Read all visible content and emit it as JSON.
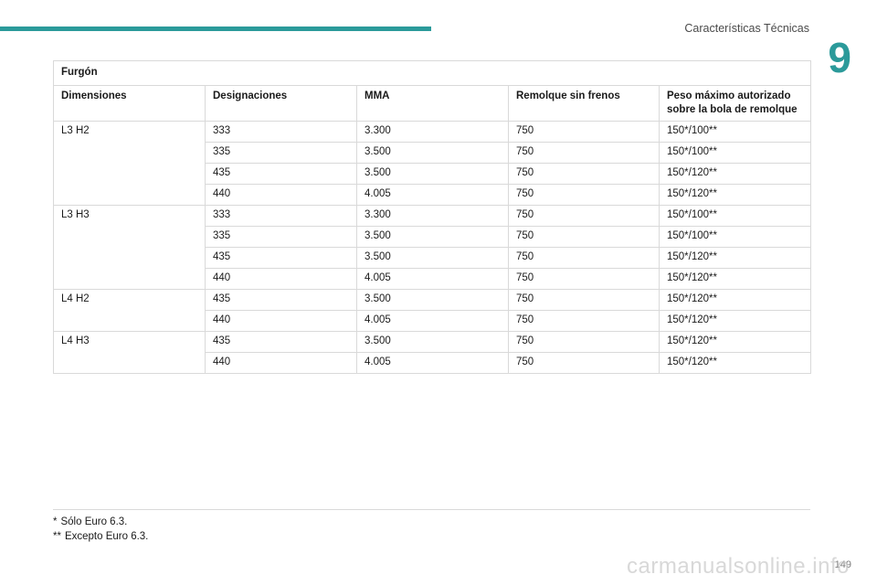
{
  "header": {
    "section_title": "Características Técnicas",
    "chapter_number": "9",
    "accent_color": "#2b9a9a"
  },
  "table": {
    "caption": "Furgón",
    "columns": [
      "Dimensiones",
      "Designaciones",
      "MMA",
      "Remolque sin frenos",
      "Peso máximo autorizado sobre la bola de remolque"
    ],
    "groups": [
      {
        "dimension": "L3 H2",
        "rows": [
          [
            "333",
            "3.300",
            "750",
            "150*/100**"
          ],
          [
            "335",
            "3.500",
            "750",
            "150*/100**"
          ],
          [
            "435",
            "3.500",
            "750",
            "150*/120**"
          ],
          [
            "440",
            "4.005",
            "750",
            "150*/120**"
          ]
        ]
      },
      {
        "dimension": "L3 H3",
        "rows": [
          [
            "333",
            "3.300",
            "750",
            "150*/100**"
          ],
          [
            "335",
            "3.500",
            "750",
            "150*/100**"
          ],
          [
            "435",
            "3.500",
            "750",
            "150*/120**"
          ],
          [
            "440",
            "4.005",
            "750",
            "150*/120**"
          ]
        ]
      },
      {
        "dimension": "L4 H2",
        "rows": [
          [
            "435",
            "3.500",
            "750",
            "150*/120**"
          ],
          [
            "440",
            "4.005",
            "750",
            "150*/120**"
          ]
        ]
      },
      {
        "dimension": "L4 H3",
        "rows": [
          [
            "435",
            "3.500",
            "750",
            "150*/120**"
          ],
          [
            "440",
            "4.005",
            "750",
            "150*/120**"
          ]
        ]
      }
    ]
  },
  "footnotes": [
    {
      "mark": "*",
      "text": "Sólo Euro 6.3."
    },
    {
      "mark": "**",
      "text": "Excepto Euro 6.3."
    }
  ],
  "page_number": "149",
  "watermark": "carmanualsonline.info"
}
